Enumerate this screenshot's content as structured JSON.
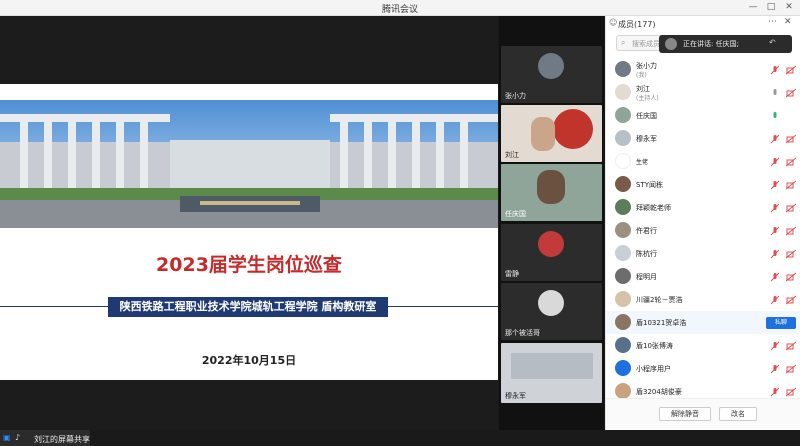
{
  "window": {
    "title": "腾讯会议"
  },
  "slide": {
    "title": "2023届学生岗位巡查",
    "subtitle": "陕西铁路工程职业技术学院城轨工程学院   盾构教研室",
    "date": "2022年10月15日"
  },
  "share_bar": {
    "label": "刘江的屏幕共享"
  },
  "video_tiles": [
    {
      "name": "张小力"
    },
    {
      "name": "刘江"
    },
    {
      "name": "任庆国"
    },
    {
      "name": "雷静"
    },
    {
      "name": "那个被活哥"
    },
    {
      "name": "穆永军"
    }
  ],
  "panel": {
    "title": "成员(177)",
    "search_placeholder": "搜索成员",
    "speaking_label": "正在讲话: 任庆国;",
    "unmute_all": "解除静音",
    "rename": "改名"
  },
  "members": [
    {
      "name": "张小力",
      "role": "(我)"
    },
    {
      "name": "刘江",
      "role": "(主持人)"
    },
    {
      "name": "任庆国",
      "role": ""
    },
    {
      "name": "穆永军",
      "role": ""
    },
    {
      "name": "生佬",
      "role": ""
    },
    {
      "name": "STY闻栋",
      "role": ""
    },
    {
      "name": "拜颖乾老师",
      "role": ""
    },
    {
      "name": "仵君行",
      "role": ""
    },
    {
      "name": "陈杭行",
      "role": ""
    },
    {
      "name": "程明月",
      "role": ""
    },
    {
      "name": "川疆2轮－贾浩",
      "role": ""
    },
    {
      "name": "盾10321贺卓浩",
      "role": "",
      "action": "私聊"
    },
    {
      "name": "盾10张博涛",
      "role": ""
    },
    {
      "name": "小程序用户",
      "role": ""
    },
    {
      "name": "盾3204胡俊豪",
      "role": ""
    }
  ],
  "colors": {
    "accent": "#1e6fe0",
    "slide_title": "#c62b2b",
    "banner": "#1f3a73",
    "muted_mic": "#e05050"
  }
}
